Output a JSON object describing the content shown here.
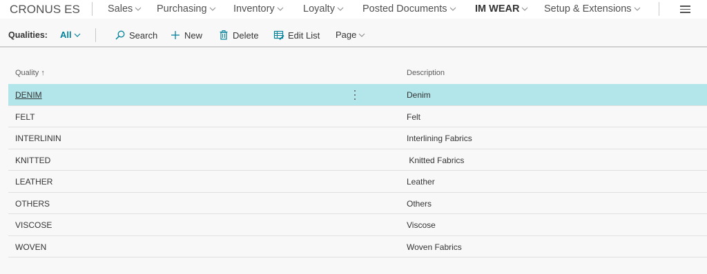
{
  "topnav": {
    "company": "CRONUS ES",
    "items": [
      {
        "label": "Sales"
      },
      {
        "label": "Purchasing"
      },
      {
        "label": "Inventory"
      },
      {
        "label": "Loyalty"
      },
      {
        "label": "Posted Documents"
      },
      {
        "label": "IM WEAR"
      },
      {
        "label": "Setup & Extensions"
      }
    ]
  },
  "actionbar": {
    "filter_label": "Qualities:",
    "filter_value": "All",
    "search": "Search",
    "new": "New",
    "delete": "Delete",
    "edit_list": "Edit List",
    "page": "Page"
  },
  "list": {
    "columns": {
      "quality": "Quality",
      "quality_sort": "↑",
      "description": "Description"
    },
    "rows": [
      {
        "quality": "DENIM",
        "description": "Denim"
      },
      {
        "quality": "FELT",
        "description": "Felt"
      },
      {
        "quality": "INTERLININ",
        "description": "Interlining Fabrics"
      },
      {
        "quality": "KNITTED",
        "description": " Knitted Fabrics"
      },
      {
        "quality": "LEATHER",
        "description": "Leather"
      },
      {
        "quality": "OTHERS",
        "description": "Others"
      },
      {
        "quality": "VISCOSE",
        "description": "Viscose"
      },
      {
        "quality": "WOVEN",
        "description": "Woven Fabrics"
      }
    ]
  },
  "colors": {
    "accent": "#00809a",
    "selected_row": "#b2e6ea"
  }
}
